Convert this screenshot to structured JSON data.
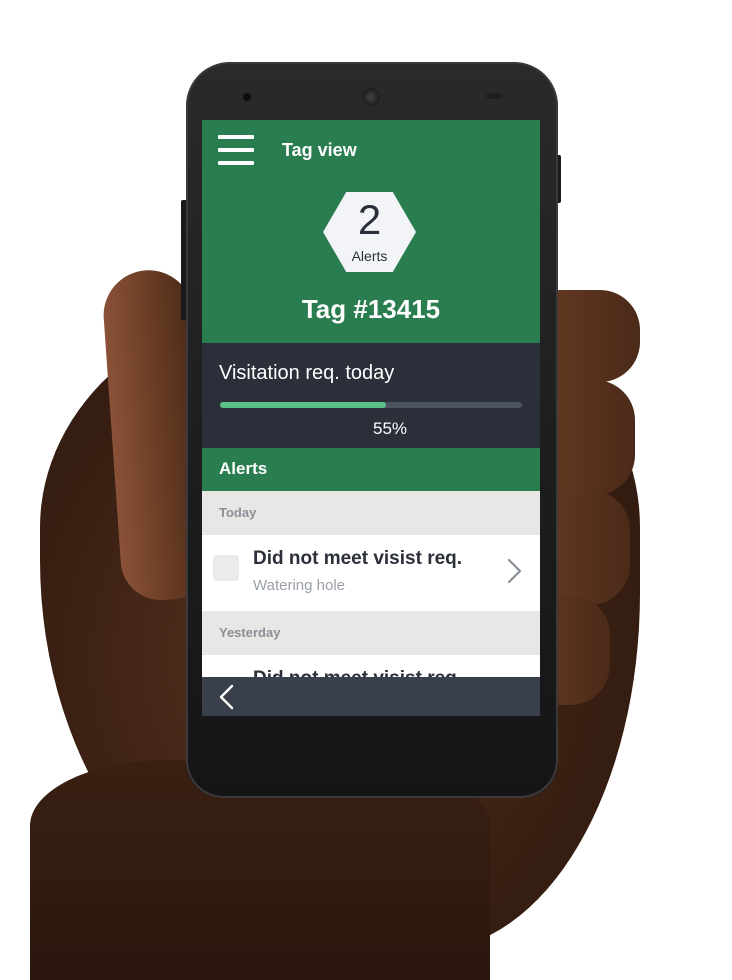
{
  "app": {
    "header_title": "Tag view",
    "alert_count": "2",
    "alert_count_label": "Alerts",
    "tag_title": "Tag #13415"
  },
  "visitation": {
    "label": "Visitation req. today",
    "percent_text": "55%",
    "progress_fraction": 0.55
  },
  "alerts": {
    "section_title": "Alerts",
    "groups": [
      {
        "label": "Today",
        "items": [
          {
            "title": "Did not meet visist req.",
            "subtitle": "Watering hole"
          }
        ]
      },
      {
        "label": "Yesterday",
        "items": [
          {
            "title": "Did not meet visist req.",
            "subtitle": ""
          }
        ]
      }
    ]
  },
  "icons": {
    "menu": "hamburger-menu-icon",
    "back": "chevron-left-icon",
    "row": "chevron-right-icon",
    "checkbox": "checkbox-icon"
  },
  "colors": {
    "brand_green": "#2a7d4f",
    "dark_panel": "#2b2f3a",
    "progress_fill": "#5cc08a",
    "section_bg": "#e8e7e5"
  }
}
